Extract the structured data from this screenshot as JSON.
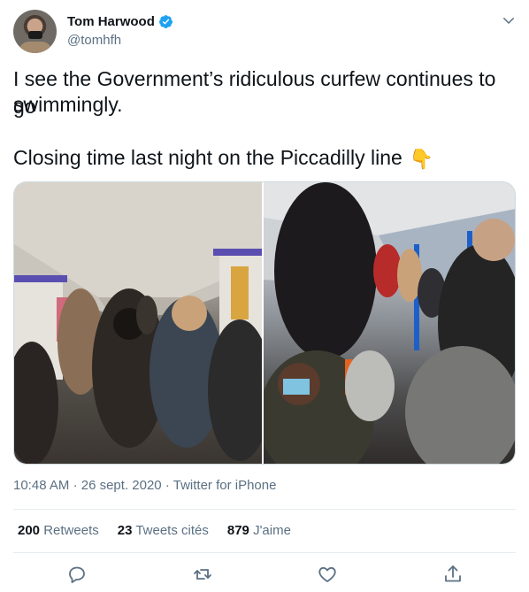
{
  "author": {
    "name": "Tom Harwood",
    "handle": "@tomhfh",
    "verified": true
  },
  "tweet": {
    "line1": "I see the Government’s ridiculous curfew continues to go",
    "line2": "swimmingly.",
    "line3": "Closing time last night on the Piccadilly line",
    "emoji": "👇"
  },
  "meta": {
    "time": "10:48 AM",
    "sep1": "·",
    "date": "26 sept. 2020",
    "sep2": "·",
    "source": "Twitter for iPhone"
  },
  "stats": {
    "retweets_count": "200",
    "retweets_label": "Retweets",
    "quotes_count": "23",
    "quotes_label": "Tweets cités",
    "likes_count": "879",
    "likes_label": "J'aime"
  },
  "icons": [
    "verified-badge-icon",
    "chevron-down-icon",
    "reply-icon",
    "retweet-icon",
    "like-icon",
    "share-icon"
  ],
  "colors": {
    "primary_text": "#0f1419",
    "secondary_text": "#5b7083",
    "accent": "#1da1f2",
    "divider": "#e6ecf0"
  }
}
